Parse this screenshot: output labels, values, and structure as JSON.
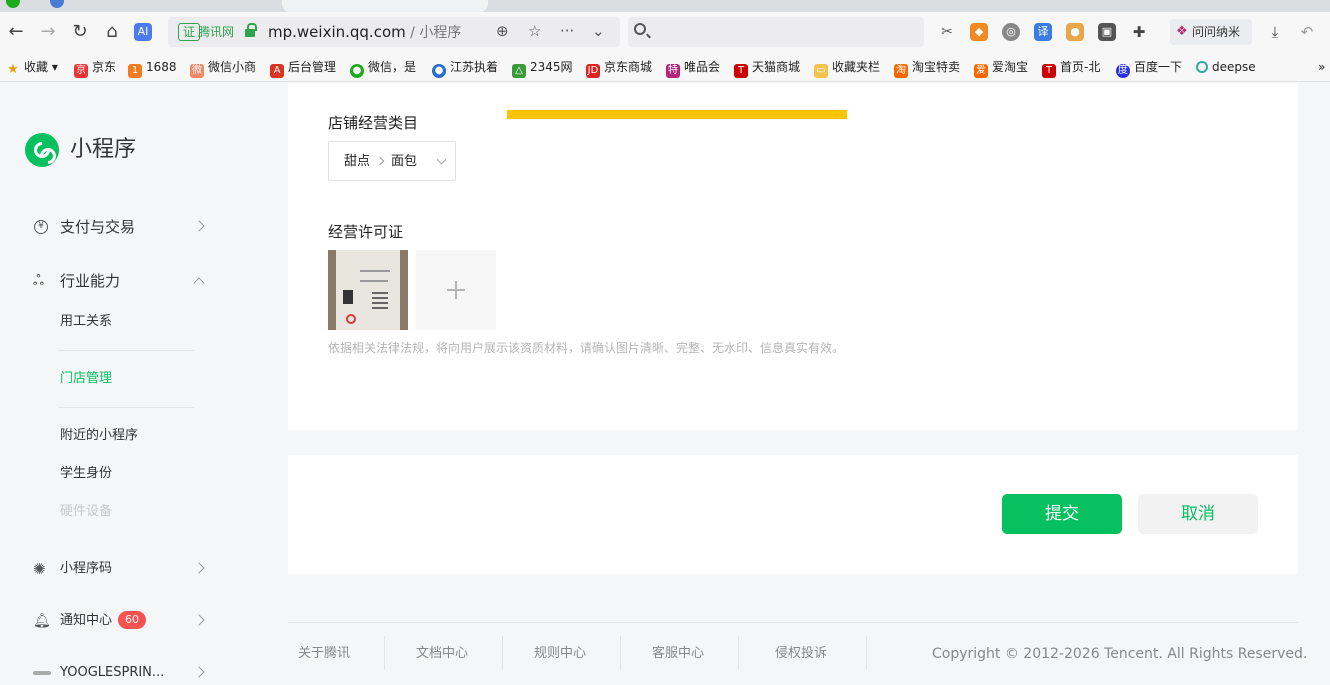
{
  "browser": {
    "url_domain": "mp.weixin.qq.com",
    "url_sep": " / ",
    "url_page": "小程序",
    "cert_badge": "证",
    "cert_text": "腾讯网",
    "ext_label": "问问纳米"
  },
  "bookmarks": [
    "收藏",
    "京东",
    "1688",
    "微信小商",
    "后台管理",
    "微信，是",
    "江苏执着",
    "2345网",
    "京东商城",
    "唯品会",
    "天猫商城",
    "收藏夹栏",
    "淘宝特卖",
    "爱淘宝",
    "首页-北",
    "百度一下",
    "deepse"
  ],
  "sidebar": {
    "app_title": "小程序",
    "menu": {
      "pay": "支付与交易",
      "industry": "行业能力",
      "qrcode": "小程序码",
      "notify": "通知中心",
      "notify_badge": "60",
      "account": "YOOGLESPRIN..."
    },
    "sub": {
      "employment": "用工关系",
      "store": "门店管理",
      "nearby": "附近的小程序",
      "student": "学生身份",
      "hardware": "硬件设备"
    }
  },
  "form": {
    "category_label": "店铺经营类目",
    "category_level1": "甜点",
    "category_level2": "面包",
    "license_label": "经营许可证",
    "hint": "依据相关法律法规，将向用户展示该资质材料，请确认图片清晰、完整、无水印、信息真实有效。"
  },
  "actions": {
    "submit": "提交",
    "cancel": "取消"
  },
  "footer": {
    "links": [
      "关于腾讯",
      "文档中心",
      "规则中心",
      "客服中心",
      "侵权投诉"
    ],
    "copyright": "Copyright © 2012-2026 Tencent. All Rights Reserved."
  },
  "colors": {
    "brand": "#07c160",
    "badge": "#fa5151",
    "highlight": "#ffc300"
  }
}
